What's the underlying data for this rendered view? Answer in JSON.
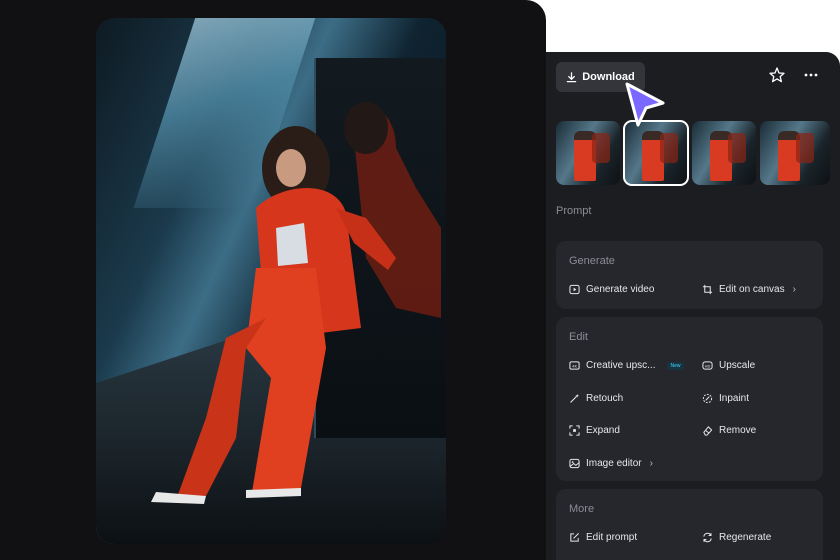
{
  "toolbar": {
    "download_label": "Download",
    "star_icon": "star-icon",
    "more_icon": "more-icon"
  },
  "prompt": {
    "label": "Prompt"
  },
  "generate": {
    "title": "Generate",
    "generate_video": "Generate video",
    "edit_on_canvas": "Edit on canvas"
  },
  "edit": {
    "title": "Edit",
    "creative_upscale": "Creative upsc...",
    "new_badge": "New",
    "upscale": "Upscale",
    "retouch": "Retouch",
    "inpaint": "Inpaint",
    "expand": "Expand",
    "remove": "Remove",
    "image_editor": "Image editor"
  },
  "more": {
    "title": "More",
    "edit_prompt": "Edit prompt",
    "regenerate": "Regenerate"
  },
  "colors": {
    "background": "#111114",
    "panel": "#1c1d21",
    "card": "#26272c",
    "cursor": "#7b68ff",
    "accent_badge": "#3fd3ff"
  }
}
